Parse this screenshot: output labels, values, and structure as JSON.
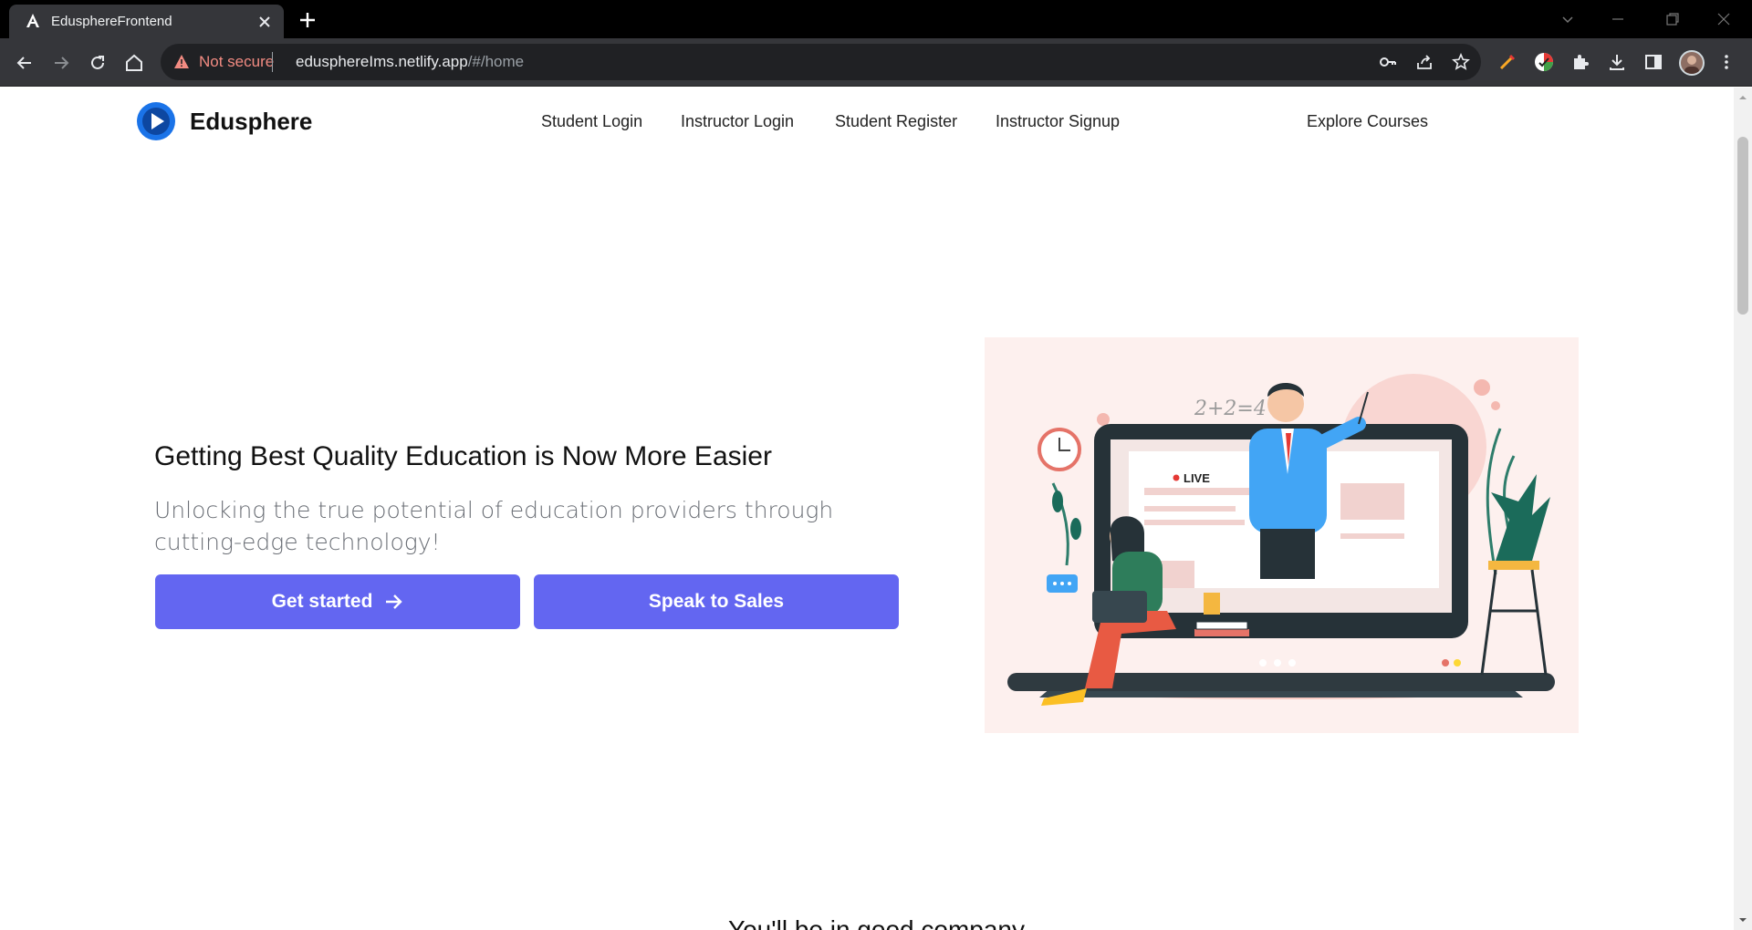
{
  "browser": {
    "tab_title": "EdusphereFrontend",
    "security_label": "Not secure",
    "url_host": "edusphere lms.netlify.app",
    "url_host_display": "edusphereIms.netlify.app",
    "url_path": "/#/home"
  },
  "header": {
    "brand": "Edusphere",
    "nav": [
      {
        "label": "Student Login"
      },
      {
        "label": "Instructor Login"
      },
      {
        "label": "Student Register"
      },
      {
        "label": "Instructor Signup"
      },
      {
        "label": "Explore Courses"
      }
    ]
  },
  "hero": {
    "headline": "Getting Best Quality Education is Now More Easier",
    "subtext": "Unlocking the true potential of education providers through cutting-edge technology!",
    "primary_button": "Get started",
    "secondary_button": "Speak to Sales",
    "illustration": {
      "equation": "2+2=4",
      "live_badge": "LIVE"
    }
  },
  "next_section": {
    "heading": "You'll be in good company"
  },
  "colors": {
    "accent": "#6366f1",
    "brand_blue": "#1a73e8",
    "hero_bg": "#fdf0ee"
  }
}
